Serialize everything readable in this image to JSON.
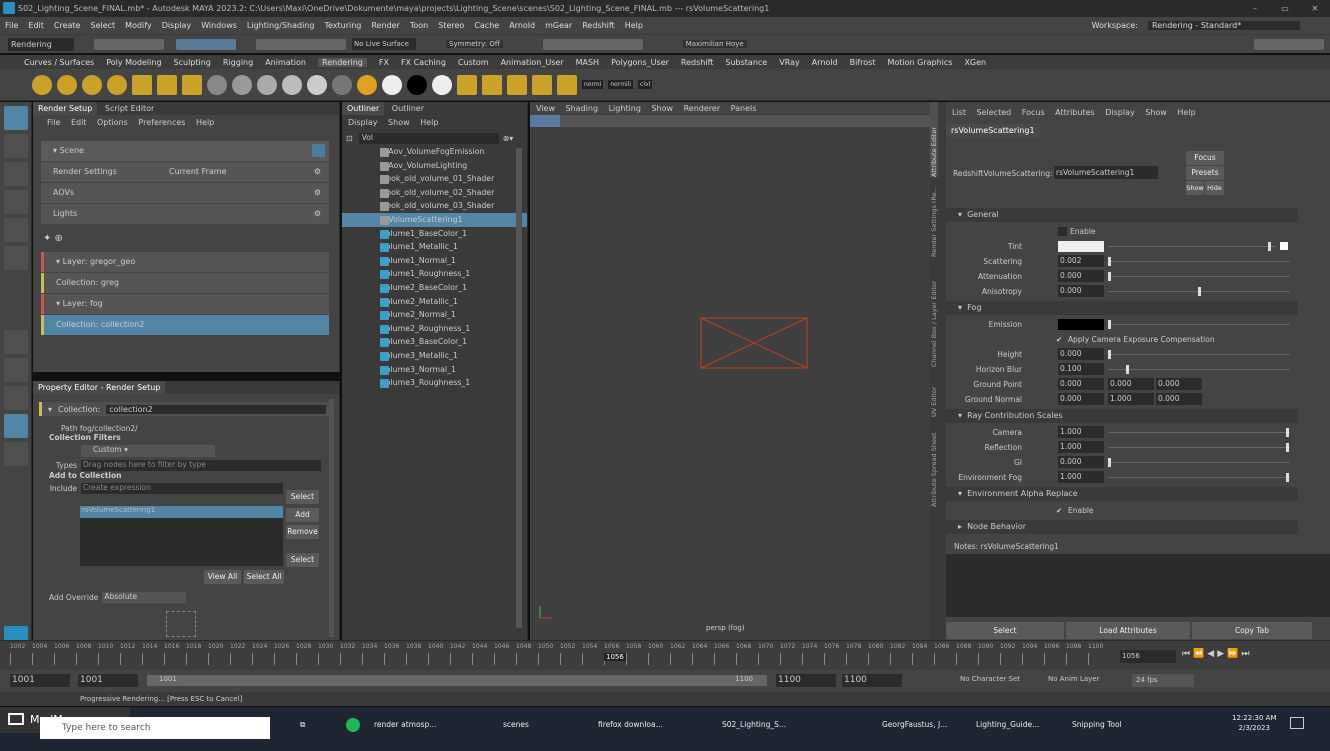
{
  "window": {
    "title": "S02_Lighting_Scene_FINAL.mb* - Autodesk MAYA 2023.2: C:\\Users\\Maxi\\OneDrive\\Dokumente\\maya\\projects\\Lighting_Scene\\scenes\\S02_Lighting_Scene_FINAL.mb  ---  rsVolumeScattering1"
  },
  "menubar": [
    "File",
    "Edit",
    "Create",
    "Select",
    "Modify",
    "Display",
    "Windows",
    "Lighting/Shading",
    "Texturing",
    "Render",
    "Toon",
    "Stereo",
    "Cache",
    "Arnold",
    "mGear",
    "Redshift",
    "Help"
  ],
  "workspace": {
    "label": "Workspace:",
    "value": "Rendering - Standard*"
  },
  "statusline": {
    "mode": "Rendering",
    "live": "No Live Surface",
    "symmetry": "Symmetry: Off",
    "user": "Maximilian Hoye"
  },
  "shelftabs": [
    "Curves / Surfaces",
    "Poly Modeling",
    "Sculpting",
    "Rigging",
    "Animation",
    "Rendering",
    "FX",
    "FX Caching",
    "Custom",
    "Animation_User",
    "MASH",
    "Polygons_User",
    "Redshift",
    "Substance",
    "VRay",
    "Arnold",
    "Bifrost",
    "Motion Graphics",
    "XGen"
  ],
  "shelf_labels": [
    "normi",
    "normili",
    "clvl"
  ],
  "render_setup": {
    "tabs": [
      "Render Setup",
      "Script Editor"
    ],
    "menu": [
      "File",
      "Edit",
      "Options",
      "Preferences",
      "Help"
    ],
    "scene": "Scene",
    "rows": [
      {
        "label": "Render Settings",
        "value": "Current Frame"
      },
      {
        "label": "AOVs",
        "value": ""
      },
      {
        "label": "Lights",
        "value": ""
      }
    ],
    "layers": [
      {
        "label": "Layer:",
        "name": "gregor_geo",
        "collection": "Collection:",
        "cname": "greg"
      },
      {
        "label": "Layer:",
        "name": "fog",
        "collection": "Collection:",
        "cname": "collection2"
      }
    ]
  },
  "prop_editor": {
    "title": "Property Editor - Render Setup",
    "collection_label": "Collection:",
    "collection_value": "collection2",
    "path_label": "Path",
    "path_value": "fog/collection2/",
    "filters_label": "Collection Filters",
    "filter_value": "Custom",
    "types_label": "Types",
    "types_placeholder": "Drag nodes here to filter by type",
    "add_label": "Add to Collection",
    "include_label": "Include",
    "include_placeholder": "Create expression",
    "list_item": "rsVolumeScattering1",
    "buttons": {
      "select": "Select",
      "add": "Add",
      "remove": "Remove",
      "select2": "Select",
      "view_all": "View All",
      "select_all": "Select All"
    },
    "override_label": "Add Override",
    "override_value": "Absolute"
  },
  "outliner": {
    "tabs": [
      "Outliner",
      "Outliner"
    ],
    "menu": [
      "Display",
      "Show",
      "Help"
    ],
    "search": "Vol",
    "items": [
      {
        "name": "rsAov_VolumeFogEmission",
        "type": "shader",
        "selected": false
      },
      {
        "name": "rsAov_VolumeLighting",
        "type": "shader",
        "selected": false
      },
      {
        "name": "Book_old_volume_01_Shader",
        "type": "shader",
        "selected": false
      },
      {
        "name": "Book_old_volume_02_Shader",
        "type": "shader",
        "selected": false
      },
      {
        "name": "Book_old_volume_03_Shader",
        "type": "shader",
        "selected": false
      },
      {
        "name": "rsVolumeScattering1",
        "type": "shader",
        "selected": true
      },
      {
        "name": "Volume1_BaseColor_1",
        "type": "file",
        "selected": false
      },
      {
        "name": "Volume1_Metallic_1",
        "type": "file",
        "selected": false
      },
      {
        "name": "Volume1_Normal_1",
        "type": "file",
        "selected": false
      },
      {
        "name": "Volume1_Roughness_1",
        "type": "file",
        "selected": false
      },
      {
        "name": "Volume2_BaseColor_1",
        "type": "file",
        "selected": false
      },
      {
        "name": "Volume2_Metallic_1",
        "type": "file",
        "selected": false
      },
      {
        "name": "Volume2_Normal_1",
        "type": "file",
        "selected": false
      },
      {
        "name": "Volume2_Roughness_1",
        "type": "file",
        "selected": false
      },
      {
        "name": "Volume3_BaseColor_1",
        "type": "file",
        "selected": false
      },
      {
        "name": "Volume3_Metallic_1",
        "type": "file",
        "selected": false
      },
      {
        "name": "Volume3_Normal_1",
        "type": "file",
        "selected": false
      },
      {
        "name": "Volume3_Roughness_1",
        "type": "file",
        "selected": false
      }
    ]
  },
  "viewport": {
    "menu": [
      "View",
      "Shading",
      "Lighting",
      "Show",
      "Renderer",
      "Panels"
    ],
    "camera": "persp (fog)"
  },
  "attr_editor": {
    "menu": [
      "List",
      "Selected",
      "Focus",
      "Attributes",
      "Display",
      "Show",
      "Help"
    ],
    "side_tabs": [
      "Attribute Editor",
      "Render Settings (Re...",
      "Channel Box / Layer Editor",
      "UV Editor",
      "Attribute Spread Sheet"
    ],
    "tab": "rsVolumeScattering1",
    "node_label": "RedshiftVolumeScattering:",
    "node_value": "rsVolumeScattering1",
    "focus": "Focus",
    "presets": "Presets",
    "show": "Show",
    "hide": "Hide",
    "general": "General",
    "enable": "Enable",
    "tint": "Tint",
    "scattering": {
      "label": "Scattering",
      "value": "0.002"
    },
    "attenuation": {
      "label": "Attenuation",
      "value": "0.000"
    },
    "anisotropy": {
      "label": "Anisotropy",
      "value": "0.000"
    },
    "fog": "Fog",
    "emission": "Emission",
    "apply_cam": "Apply Camera Exposure Compensation",
    "height": {
      "label": "Height",
      "value": "0.000"
    },
    "horizon": {
      "label": "Horizon Blur",
      "value": "0.100"
    },
    "ground_point": {
      "label": "Ground Point",
      "values": [
        "0.000",
        "0.000",
        "0.000"
      ]
    },
    "ground_normal": {
      "label": "Ground Normal",
      "values": [
        "0.000",
        "1.000",
        "0.000"
      ]
    },
    "ray": "Ray Contribution Scales",
    "camera": {
      "label": "Camera",
      "value": "1.000"
    },
    "reflection": {
      "label": "Reflection",
      "value": "1.000"
    },
    "gi": {
      "label": "GI",
      "value": "0.000"
    },
    "envfog": {
      "label": "Environment Fog",
      "value": "1.000"
    },
    "env_alpha": "Environment Alpha Replace",
    "enable2": "Enable",
    "node_behavior": "Node Behavior",
    "notes": "Notes: rsVolumeScattering1",
    "bottom_buttons": [
      "Select",
      "Load Attributes",
      "Copy Tab"
    ]
  },
  "timeline": {
    "ticks": [
      "1002",
      "1004",
      "1006",
      "1008",
      "1010",
      "1012",
      "1014",
      "1016",
      "1018",
      "1020",
      "1022",
      "1024",
      "1026",
      "1028",
      "1030",
      "1032",
      "1034",
      "1036",
      "1038",
      "1040",
      "1042",
      "1044",
      "1046",
      "1048",
      "1050",
      "1052",
      "1054",
      "1056",
      "1058",
      "1060",
      "1062",
      "1064",
      "1066",
      "1068",
      "1070",
      "1072",
      "1074",
      "1076",
      "1078",
      "1080",
      "1082",
      "1084",
      "1086",
      "1088",
      "1090",
      "1092",
      "1094",
      "1096",
      "1098",
      "1100"
    ],
    "current": "1056",
    "current_field": "1056"
  },
  "range": {
    "start": "1001",
    "start2": "1001",
    "start3": "1001",
    "end": "1100",
    "end2": "1100",
    "end3": "1100",
    "charset": "No Character Set",
    "animlayer": "No Anim Layer",
    "fps": "24 fps"
  },
  "cmdline": "Progressive Rendering... [Press ESC to Cancel]",
  "taskbar": {
    "search": "Type here to search",
    "madmax": "MadMax",
    "apps": [
      "render atmosp...",
      "scenes",
      "firefox downloa...",
      "S02_Lighting_S...",
      "GeorgFaustus, J...",
      "Lighting_Guide...",
      "Snipping Tool"
    ],
    "time": "12:22:30 AM",
    "date": "2/3/2023"
  }
}
